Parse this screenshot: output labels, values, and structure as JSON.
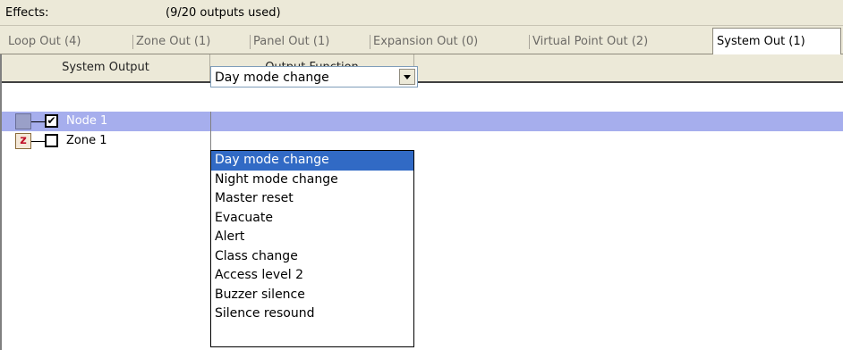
{
  "effects": {
    "label": "Effects:",
    "outputs_used": "(9/20 outputs used)"
  },
  "tabs": [
    {
      "label": "Loop Out (4)"
    },
    {
      "label": "Zone Out (1)"
    },
    {
      "label": "Panel Out (1)"
    },
    {
      "label": "Expansion Out (0)"
    },
    {
      "label": "Virtual Point Out (2)"
    },
    {
      "label": "System Out (1)",
      "active": true
    }
  ],
  "grid": {
    "columns": [
      "System Output",
      "Output Function"
    ],
    "rows": [
      {
        "label": "Node 1",
        "checked": true,
        "icon": "node-icon",
        "selected": true
      },
      {
        "label": "Zone 1",
        "checked": false,
        "icon": "zone-icon",
        "selected": false
      }
    ]
  },
  "combo": {
    "value": "Day mode change"
  },
  "dropdown": {
    "options": [
      "Day mode change",
      "Night mode change",
      "Master reset",
      "Evacuate",
      "Alert",
      "Class change",
      "Access level 2",
      "Buzzer silence",
      "Silence resound"
    ],
    "highlighted": "Day mode change"
  },
  "colors": {
    "selected_row": "#a6aeed",
    "highlight": "#316ac5",
    "chrome": "#ece9d8"
  },
  "icons": {
    "checkbox_checked": "✔",
    "zone_glyph": "z"
  }
}
